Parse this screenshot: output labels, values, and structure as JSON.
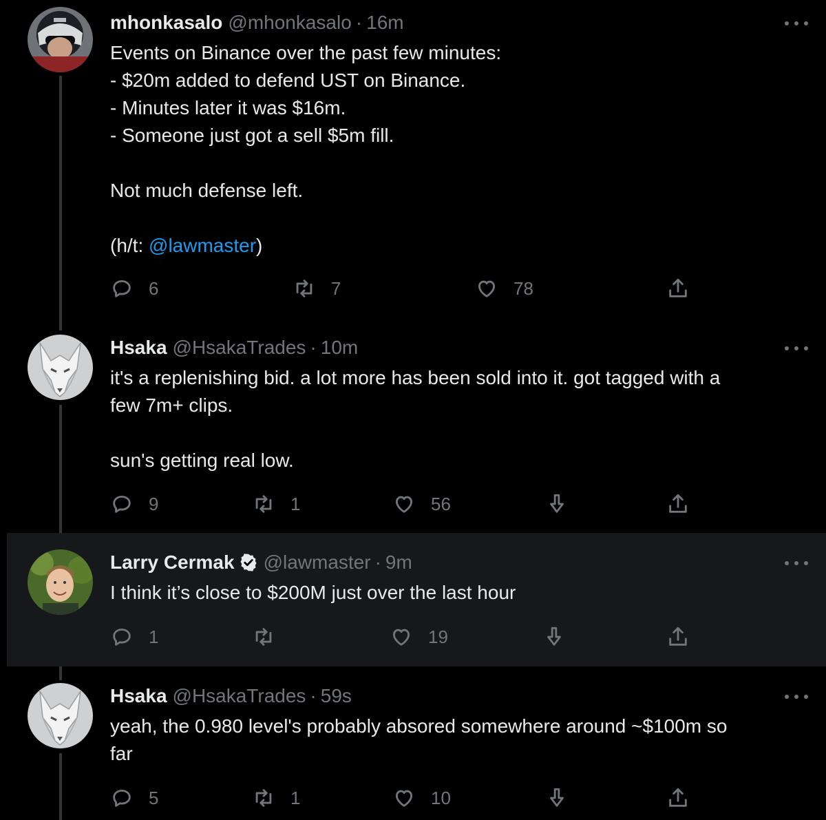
{
  "tweets": [
    {
      "name": "mhonkasalo",
      "handle": "@mhonkasalo",
      "separator": "·",
      "time": "16m",
      "body_pre": "Events on Binance over the past few minutes:\n- $20m added to defend UST on Binance.\n- Minutes later it was $16m.\n- Someone just got a sell $5m fill.\n\nNot much defense left.\n\n(h/t: ",
      "mention": "@lawmaster",
      "body_post": ")",
      "replies": "6",
      "retweets": "7",
      "likes": "78"
    },
    {
      "name": "Hsaka",
      "handle": "@HsakaTrades",
      "separator": "·",
      "time": "10m",
      "body": "it's a replenishing bid. a lot more has been sold into it. got tagged with a\nfew 7m+ clips.\n\nsun's getting real low.",
      "replies": "9",
      "retweets": "1",
      "likes": "56"
    },
    {
      "name": "Larry Cermak",
      "handle": "@lawmaster",
      "separator": "·",
      "time": "9m",
      "body": "I think it’s close to $200M just over the last hour",
      "replies": "1",
      "retweets": "",
      "likes": "19"
    },
    {
      "name": "Hsaka",
      "handle": "@HsakaTrades",
      "separator": "·",
      "time": "59s",
      "body": "yeah, the 0.980 level's probably absored somewhere around ~$100m so\nfar",
      "replies": "5",
      "retweets": "1",
      "likes": "10"
    }
  ],
  "colors": {
    "background": "#000000",
    "highlight": "#16181c",
    "text": "#e7e9ea",
    "muted": "#71767b",
    "link": "#1d9bf0",
    "thread_line": "#333639"
  },
  "icons": [
    "reply-icon",
    "retweet-icon",
    "like-icon",
    "tip-icon",
    "share-icon",
    "more-icon",
    "verified-badge-icon"
  ]
}
